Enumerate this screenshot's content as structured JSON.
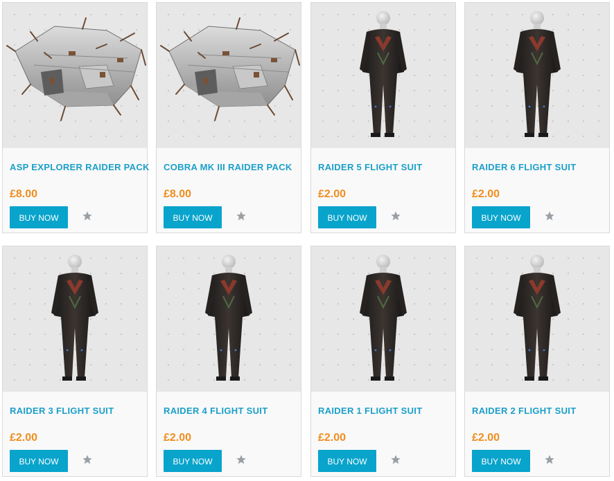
{
  "colors": {
    "title": "#1a9fc9",
    "price": "#f08d1e",
    "button": "#08a4cc",
    "star": "#9aa0a6"
  },
  "products": [
    {
      "title": "ASP EXPLORER RAIDER PACK",
      "price": "£8.00",
      "button": "BUY NOW",
      "image": "ship",
      "wishlist_icon": "star-icon"
    },
    {
      "title": "COBRA MK III RAIDER PACK",
      "price": "£8.00",
      "button": "BUY NOW",
      "image": "ship",
      "wishlist_icon": "star-icon"
    },
    {
      "title": "RAIDER 5 FLIGHT SUIT",
      "price": "£2.00",
      "button": "BUY NOW",
      "image": "suit",
      "wishlist_icon": "star-icon"
    },
    {
      "title": "RAIDER 6 FLIGHT SUIT",
      "price": "£2.00",
      "button": "BUY NOW",
      "image": "suit",
      "wishlist_icon": "star-icon"
    },
    {
      "title": "RAIDER 3 FLIGHT SUIT",
      "price": "£2.00",
      "button": "BUY NOW",
      "image": "suit",
      "wishlist_icon": "star-icon"
    },
    {
      "title": "RAIDER 4 FLIGHT SUIT",
      "price": "£2.00",
      "button": "BUY NOW",
      "image": "suit",
      "wishlist_icon": "star-icon"
    },
    {
      "title": "RAIDER 1 FLIGHT SUIT",
      "price": "£2.00",
      "button": "BUY NOW",
      "image": "suit",
      "wishlist_icon": "star-icon"
    },
    {
      "title": "RAIDER 2 FLIGHT SUIT",
      "price": "£2.00",
      "button": "BUY NOW",
      "image": "suit",
      "wishlist_icon": "star-icon"
    }
  ]
}
